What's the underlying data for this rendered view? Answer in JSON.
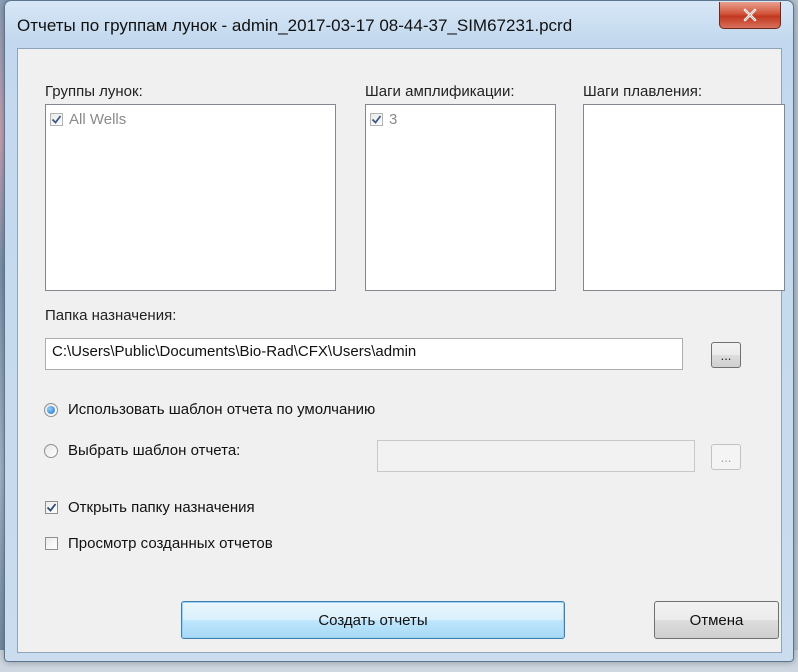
{
  "window": {
    "title": "Отчеты по группам лунок - admin_2017-03-17 08-44-37_SIM67231.pcrd",
    "close_icon": "close-x-icon"
  },
  "well_groups": {
    "label": "Группы лунок:",
    "items": [
      {
        "label": "All Wells",
        "checked": true
      }
    ]
  },
  "amplification_steps": {
    "label": "Шаги амплификации:",
    "items": [
      {
        "label": "3",
        "checked": true
      }
    ]
  },
  "melt_steps": {
    "label": "Шаги плавления:",
    "items": []
  },
  "destination": {
    "label": "Папка назначения:",
    "value": "C:\\Users\\Public\\Documents\\Bio-Rad\\CFX\\Users\\admin",
    "browse_label": "..."
  },
  "template": {
    "use_default_label": "Использовать шаблон отчета по умолчанию",
    "use_default_selected": true,
    "choose_label": "Выбрать шаблон отчета:",
    "choose_selected": false,
    "choose_value": "",
    "browse_label": "..."
  },
  "options": {
    "open_folder_label": "Открыть папку назначения",
    "open_folder_checked": true,
    "view_reports_label": "Просмотр созданных отчетов",
    "view_reports_checked": false
  },
  "buttons": {
    "create_label": "Создать отчеты",
    "cancel_label": "Отмена"
  }
}
